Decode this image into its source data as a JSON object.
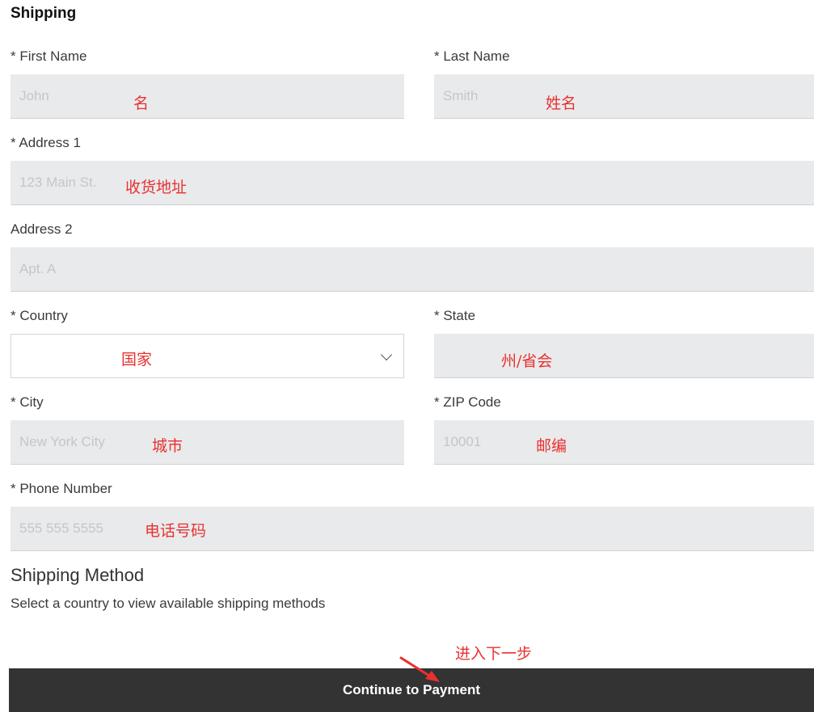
{
  "shipping": {
    "title": "Shipping",
    "first_name": {
      "label": "* First Name",
      "placeholder": "John",
      "annotation": "名"
    },
    "last_name": {
      "label": "* Last Name",
      "placeholder": "Smith",
      "annotation": "姓名"
    },
    "address1": {
      "label": "* Address 1",
      "placeholder": "123 Main St.",
      "annotation": "收货地址"
    },
    "address2": {
      "label": "Address 2",
      "placeholder": "Apt. A"
    },
    "country": {
      "label": "* Country",
      "value": "",
      "annotation": "国家"
    },
    "state": {
      "label": "* State",
      "placeholder": "",
      "annotation": "州/省会"
    },
    "city": {
      "label": "* City",
      "placeholder": "New York City",
      "annotation": "城市"
    },
    "zip": {
      "label": "* ZIP Code",
      "placeholder": "10001",
      "annotation": "邮编"
    },
    "phone": {
      "label": "* Phone Number",
      "placeholder": "555 555 5555",
      "annotation": "电话号码"
    }
  },
  "shipping_method": {
    "title": "Shipping Method",
    "note": "Select a country to view available shipping methods"
  },
  "continue": {
    "label": "Continue to Payment",
    "annotation": "进入下一步"
  },
  "colors": {
    "annotation": "#e8312f",
    "button": "#333333",
    "field": "#e9eaec"
  },
  "icons": {
    "select": "chevron-down-icon",
    "pointer": "red-arrow-icon"
  }
}
